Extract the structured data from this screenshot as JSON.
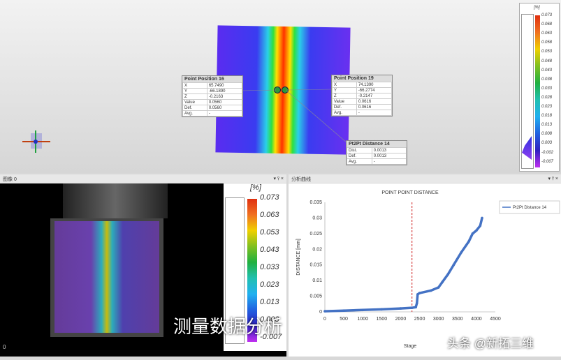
{
  "view3d": {
    "p16": {
      "title": "Point Position 16",
      "rows": [
        [
          "X",
          "65.7490"
        ],
        [
          "Y",
          "-66.1890"
        ],
        [
          "Z",
          "-0.2163"
        ],
        [
          "Value",
          "0.0560"
        ],
        [
          "Def.",
          "0.0560"
        ],
        [
          "Avg.",
          "-"
        ]
      ]
    },
    "p19": {
      "title": "Point Position 19",
      "rows": [
        [
          "X",
          "74.1390"
        ],
        [
          "Y",
          "-66.2774"
        ],
        [
          "Z",
          "-0.2147"
        ],
        [
          "Value",
          "0.0616"
        ],
        [
          "Def.",
          "0.0616"
        ],
        [
          "Avg.",
          "-"
        ]
      ]
    },
    "d14": {
      "title": "Pt2Pt Distance 14",
      "rows": [
        [
          "Dist.",
          "0.0013"
        ],
        [
          "Def.",
          "0.0013"
        ],
        [
          "Avg.",
          "-"
        ]
      ]
    },
    "scale_unit": "[%]",
    "scale": [
      "0.073",
      "0.068",
      "0.063",
      "0.058",
      "0.053",
      "0.048",
      "0.043",
      "0.038",
      "0.033",
      "0.028",
      "0.023",
      "0.018",
      "0.013",
      "0.008",
      "0.003",
      "-0.002",
      "-0.007"
    ]
  },
  "image_panel": {
    "title": "图像 0",
    "controls": "▾ ⫯ ×",
    "unit": "[%]",
    "scale": [
      "0.073",
      "0.063",
      "0.053",
      "0.043",
      "0.033",
      "0.023",
      "0.013",
      "0.003",
      "-0.007"
    ],
    "corner": "0"
  },
  "chart_panel": {
    "title": "分析曲线",
    "controls": "▾ ⫯ ×"
  },
  "subtitle": "测量数据分析",
  "watermark": "头条 @新拓三维",
  "chart_data": {
    "type": "line",
    "title": "POINT POINT DISTANCE",
    "xlabel": "Stage",
    "ylabel": "DISTANCE [mm]",
    "xlim": [
      0,
      4500
    ],
    "ylim": [
      0,
      0.035
    ],
    "xticks": [
      "0",
      "500",
      "1000",
      "1500",
      "2000",
      "2500",
      "3000",
      "3500",
      "4000",
      "4500"
    ],
    "yticks": [
      "0",
      "0.005",
      "0.01",
      "0.015",
      "0.02",
      "0.025",
      "0.03",
      "0.035"
    ],
    "legend": "Pt2Pt Distance 14",
    "legend_position": "top-right",
    "marker_line_x": 2300,
    "series": [
      {
        "name": "Pt2Pt Distance 14",
        "color": "#4472c4",
        "x": [
          0,
          500,
          1000,
          1500,
          2000,
          2300,
          2400,
          2430,
          2450,
          2500,
          2800,
          3000,
          3100,
          3250,
          3400,
          3600,
          3800,
          3900,
          4000,
          4100,
          4150
        ],
        "y": [
          0.0002,
          0.0004,
          0.0006,
          0.0008,
          0.0011,
          0.0013,
          0.0015,
          0.0028,
          0.0056,
          0.006,
          0.0068,
          0.0078,
          0.0095,
          0.012,
          0.015,
          0.019,
          0.0225,
          0.025,
          0.026,
          0.0275,
          0.03
        ]
      }
    ]
  }
}
